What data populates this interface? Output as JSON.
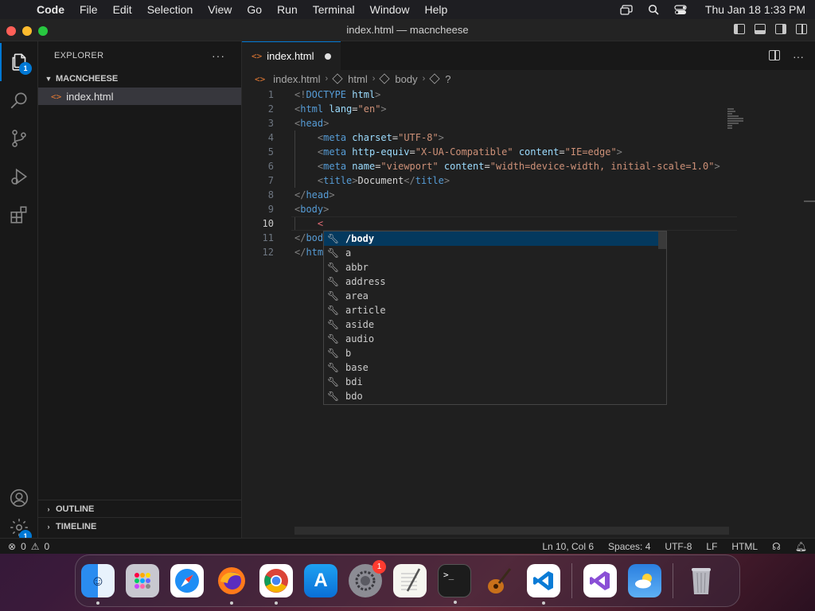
{
  "menubar": {
    "app_name": "Code",
    "items": [
      "File",
      "Edit",
      "Selection",
      "View",
      "Go",
      "Run",
      "Terminal",
      "Window",
      "Help"
    ],
    "clock": "Thu Jan 18  1:33 PM"
  },
  "window": {
    "title": "index.html — macncheese"
  },
  "activity_bar": {
    "explorer_badge": "1",
    "settings_badge": "1"
  },
  "sidebar": {
    "header": "EXPLORER",
    "more": "···",
    "folder": "MACNCHEESE",
    "files": [
      "index.html"
    ],
    "outline": "OUTLINE",
    "timeline": "TIMELINE"
  },
  "editor": {
    "tab_label": "index.html",
    "breadcrumbs": [
      "index.html",
      "html",
      "body",
      "?"
    ],
    "line_numbers": [
      "1",
      "2",
      "3",
      "4",
      "5",
      "6",
      "7",
      "8",
      "9",
      "10",
      "11",
      "12"
    ],
    "current_line": 10
  },
  "suggestions": {
    "items": [
      "/body",
      "a",
      "abbr",
      "address",
      "area",
      "article",
      "aside",
      "audio",
      "b",
      "base",
      "bdi",
      "bdo"
    ],
    "selected_index": 0
  },
  "statusbar": {
    "errors": "0",
    "warnings": "0",
    "position": "Ln 10, Col 6",
    "spaces": "Spaces: 4",
    "encoding": "UTF-8",
    "eol": "LF",
    "language": "HTML"
  },
  "dock": {
    "apps": [
      "finder-icon",
      "launchpad-icon",
      "safari-icon",
      "firefox-icon",
      "chrome-icon",
      "app-store-icon",
      "system-settings-icon",
      "textedit-icon",
      "terminal-icon",
      "garageband-icon",
      "vscode-icon",
      "visual-studio-icon",
      "weather-icon",
      "trash-icon"
    ],
    "system_settings_badge": "1"
  },
  "colors": {
    "accent": "#0078d4",
    "editor_bg": "#1f1f1f",
    "sidebar_bg": "#181818",
    "tag": "#569cd6",
    "attribute": "#9cdcfe",
    "string": "#ce9178"
  }
}
